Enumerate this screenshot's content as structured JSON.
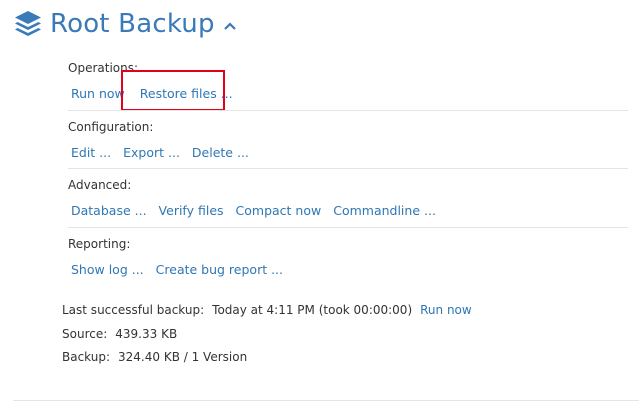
{
  "app": {
    "title": "Root Backup",
    "accent": "#3a7ab8",
    "link_color": "#2f77b4",
    "highlight_color": "#e3001b"
  },
  "header": {
    "icon": "stack-layers-icon",
    "collapse_icon": "chevron-up-icon"
  },
  "sections": {
    "operations": {
      "title": "Operations:",
      "links": [
        "Run now",
        "Restore files ..."
      ]
    },
    "configuration": {
      "title": "Configuration:",
      "links": [
        "Edit ...",
        "Export ...",
        "Delete ..."
      ]
    },
    "advanced": {
      "title": "Advanced:",
      "links": [
        "Database ...",
        "Verify files",
        "Compact now",
        "Commandline ..."
      ]
    },
    "reporting": {
      "title": "Reporting:",
      "links": [
        "Show log ...",
        "Create bug report ..."
      ]
    }
  },
  "info": {
    "last_backup_label": "Last successful backup:",
    "last_backup_value": "Today at 4:11 PM (took 00:00:00)",
    "run_now": "Run now",
    "source_label": "Source:",
    "source_value": "439.33 KB",
    "backup_label": "Backup:",
    "backup_value": "324.40 KB / 1 Version"
  }
}
